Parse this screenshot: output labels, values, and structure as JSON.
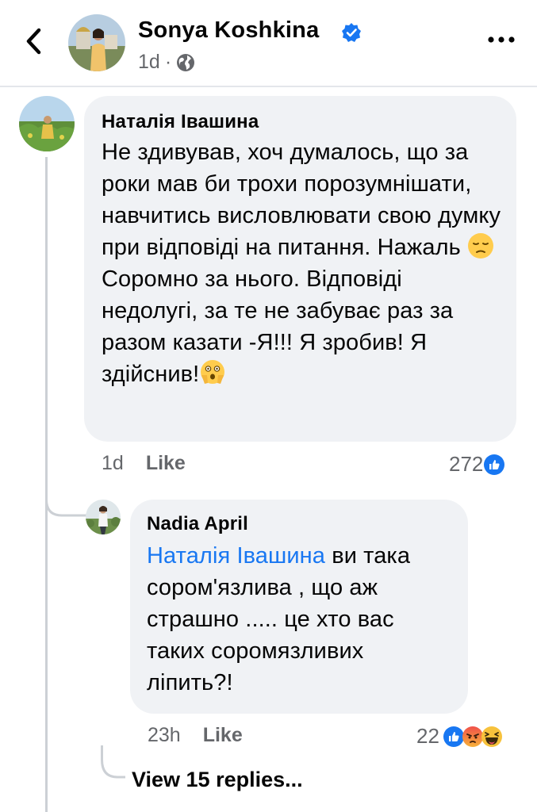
{
  "header": {
    "author_name": "Sonya Koshkina",
    "time": "1d",
    "separator": "·",
    "icons": {
      "back": "chevron-left-icon",
      "verified": "verified-badge-icon",
      "audience": "globe-icon",
      "more": "more-horizontal-icon"
    }
  },
  "comments": [
    {
      "author": "Наталія Івашина",
      "text": "Не здивував, хоч думалось, що за роки мав би трохи порозумнішати, навчитись висловлювати свою думку при відповіді на питання. Нажаль",
      "text_2": "Соромно за нього. Відповіді недолугі, за те не забуває раз за разом казати -Я!!! Я зробив! Я здійснив!",
      "emojis": [
        "pensive-face-emoji",
        "face-with-open-eyes-and-hand-over-mouth-emoji"
      ],
      "time": "1d",
      "like_label": "Like",
      "reaction_count": "272",
      "reaction_icons": [
        "like-reaction-icon"
      ]
    },
    {
      "author": "Nadia April",
      "mention": "Наталія Івашина",
      "text": " ви така сором'язлива , що аж страшно ..... це хто вас таких соромязливих ліпить?!",
      "time": "23h",
      "like_label": "Like",
      "reaction_count": "22",
      "reaction_icons": [
        "like-reaction-icon",
        "angry-reaction-icon",
        "haha-reaction-icon"
      ]
    }
  ],
  "view_replies_label": "View 15 replies...",
  "colors": {
    "bubble": "#f0f2f5",
    "mention": "#1877f2",
    "secondary_text": "#65676b",
    "like_blue": "#1877f2",
    "thread_line": "#ccd0d5"
  }
}
